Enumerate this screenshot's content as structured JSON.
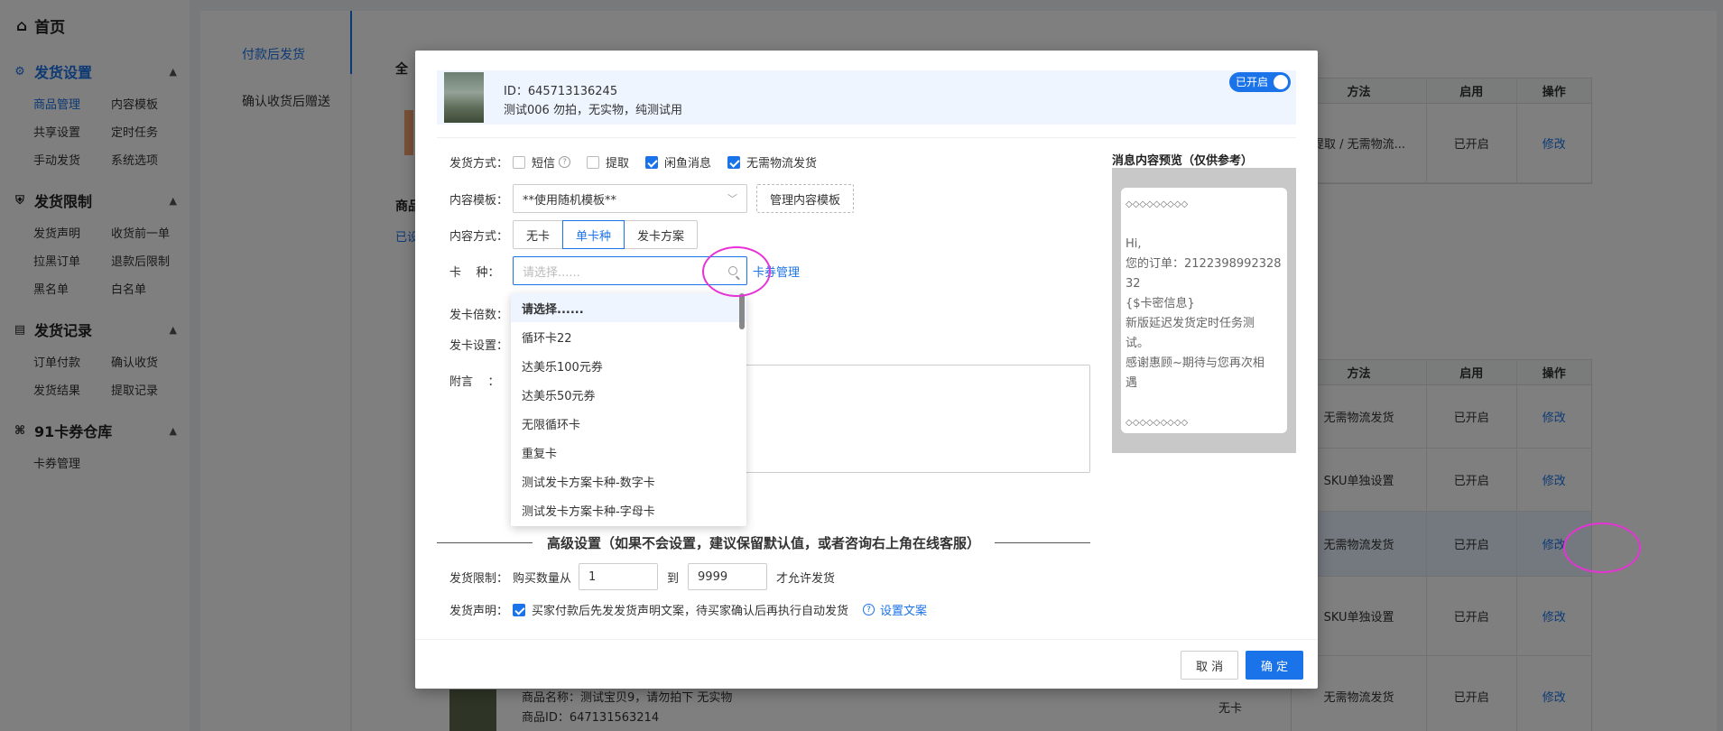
{
  "sidebar": {
    "home": "首页",
    "groups": [
      {
        "title": "发货设置",
        "items": [
          "商品管理",
          "内容模板",
          "共享设置",
          "定时任务",
          "手动发货",
          "系统选项"
        ]
      },
      {
        "title": "发货限制",
        "items": [
          "发货声明",
          "收货前一单",
          "拉黑订单",
          "退款后限制",
          "黑名单",
          "白名单"
        ]
      },
      {
        "title": "发货记录",
        "items": [
          "订单付款",
          "确认收货",
          "发货结果",
          "提取记录"
        ]
      },
      {
        "title": "91卡券仓库",
        "items": [
          "卡券管理"
        ]
      }
    ]
  },
  "subnav": [
    "付款后发货",
    "确认收货后赠送"
  ],
  "background": {
    "label_all": "全",
    "label_goods": "商品",
    "label_tab": "已设",
    "table_headers": [
      "方法",
      "启用",
      "操作"
    ],
    "rows": [
      {
        "method": "提取 / 无需物流...",
        "enabled": "已开启",
        "action": "修改"
      }
    ],
    "table2_rows": [
      {
        "method": "无需物流发货",
        "enabled": "已开启",
        "action": "修改"
      },
      {
        "method": "SKU单独设置",
        "enabled": "已开启",
        "action": "修改"
      },
      {
        "method": "无需物流发货",
        "enabled": "已开启",
        "action": "修改"
      },
      {
        "method": "SKU单独设置",
        "enabled": "已开启",
        "action": "修改"
      },
      {
        "method": "无需物流发货",
        "enabled": "已开启",
        "action": "修改",
        "card": "无卡"
      }
    ],
    "bottom_product_name": "商品名称：测试宝贝9，请勿拍下 无实物",
    "bottom_product_id": "商品ID：647131563214"
  },
  "modal": {
    "product_id": "ID：645713136245",
    "product_name": "测试006 勿拍，无实物，纯测试用",
    "toggle_label": "已开启",
    "delivery_label": "发货方式：",
    "delivery_options": [
      {
        "label": "短信",
        "checked": false
      },
      {
        "label": "提取",
        "checked": false
      },
      {
        "label": "闲鱼消息",
        "checked": true
      },
      {
        "label": "无需物流发货",
        "checked": true
      }
    ],
    "template_label": "内容模板：",
    "template_value": "**使用随机模板**",
    "manage_template": "管理内容模板",
    "content_mode_label": "内容方式：",
    "content_modes": [
      "无卡",
      "单卡种",
      "发卡方案"
    ],
    "content_mode_selected": 1,
    "card_type_label": "卡    种：",
    "card_type_placeholder": "请选择......",
    "card_manage_link": "卡券管理",
    "multiplier_label": "发卡倍数：",
    "card_setting_label": "发卡设置：",
    "note_label": "附言    ：",
    "dropdown_items": [
      "请选择......",
      "循环卡22",
      "达美乐100元券",
      "达美乐50元券",
      "无限循环卡",
      "重复卡",
      "测试发卡方案卡种-数字卡",
      "测试发卡方案卡种-字母卡"
    ],
    "advanced_title": "高级设置（如果不会设置，建议保留默认值，或者咨询右上角在线客服）",
    "limit_label": "发货限制：",
    "limit_from_text": "购买数量从",
    "limit_min": "1",
    "limit_to_text": "到",
    "limit_max": "9999",
    "limit_suffix": "才允许发货",
    "statement_label": "发货声明：",
    "statement_text": "买家付款后先发发货声明文案，待买家确认后再执行自动发货",
    "statement_link": "设置文案",
    "preview_title": "消息内容预览（仅供参考）",
    "preview_lines": [
      "◇◇◇◇◇◇◇◇◇",
      "",
      "Hi,",
      "您的订单：2122398992328",
      "32",
      "{$卡密信息}",
      "新版延迟发货定时任务测",
      "试。",
      "感谢惠顾~期待与您再次相",
      "遇",
      "",
      "◇◇◇◇◇◇◇◇◇"
    ],
    "cancel": "取 消",
    "confirm": "确 定"
  }
}
